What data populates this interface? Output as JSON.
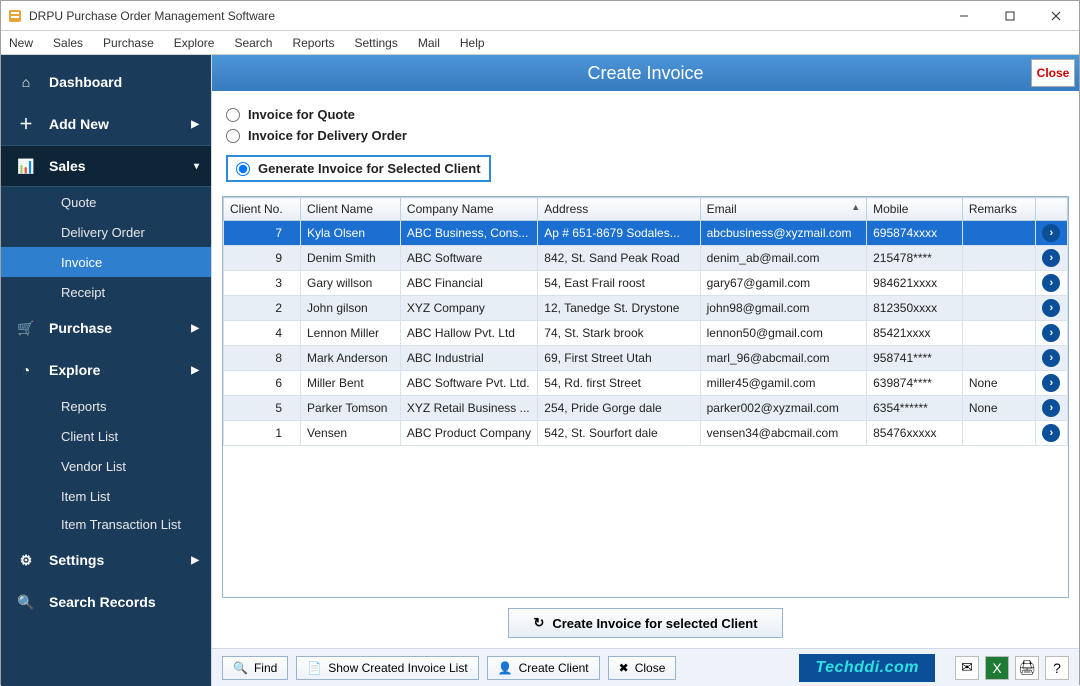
{
  "window": {
    "title": "DRPU Purchase Order Management Software"
  },
  "menubar": [
    "New",
    "Sales",
    "Purchase",
    "Explore",
    "Search",
    "Reports",
    "Settings",
    "Mail",
    "Help"
  ],
  "sidebar": {
    "dashboard": "Dashboard",
    "add_new": "Add New",
    "sales": {
      "label": "Sales",
      "items": [
        "Quote",
        "Delivery Order",
        "Invoice",
        "Receipt"
      ]
    },
    "purchase": "Purchase",
    "explore": {
      "label": "Explore",
      "items": [
        "Reports",
        "Client List",
        "Vendor List",
        "Item List",
        "Item Transaction List"
      ]
    },
    "settings": "Settings",
    "search": "Search Records"
  },
  "page": {
    "title": "Create Invoice",
    "close": "Close",
    "radios": {
      "quote": "Invoice for Quote",
      "delivery": "Invoice for Delivery Order",
      "client": "Generate Invoice for Selected Client"
    },
    "create_btn": "Create Invoice for selected Client"
  },
  "table": {
    "headers": [
      "Client No.",
      "Client Name",
      "Company Name",
      "Address",
      "Email",
      "Mobile",
      "Remarks",
      ""
    ],
    "rows": [
      {
        "no": "7",
        "name": "Kyla Olsen",
        "company": "ABC Business, Cons...",
        "address": "Ap # 651-8679 Sodales...",
        "email": "abcbusiness@xyzmail.com",
        "mobile": "695874xxxx",
        "remarks": "",
        "sel": true
      },
      {
        "no": "9",
        "name": "Denim Smith",
        "company": "ABC Software",
        "address": "842, St. Sand Peak Road",
        "email": "denim_ab@mail.com",
        "mobile": "215478****",
        "remarks": ""
      },
      {
        "no": "3",
        "name": "Gary willson",
        "company": "ABC Financial",
        "address": "54, East Frail roost",
        "email": "gary67@gamil.com",
        "mobile": "984621xxxx",
        "remarks": ""
      },
      {
        "no": "2",
        "name": "John gilson",
        "company": "XYZ Company",
        "address": "12, Tanedge St. Drystone",
        "email": "john98@gmail.com",
        "mobile": "812350xxxx",
        "remarks": ""
      },
      {
        "no": "4",
        "name": "Lennon Miller",
        "company": "ABC Hallow Pvt. Ltd",
        "address": "74, St. Stark brook",
        "email": "lennon50@gmail.com",
        "mobile": "85421xxxx",
        "remarks": ""
      },
      {
        "no": "8",
        "name": "Mark Anderson",
        "company": "ABC Industrial",
        "address": "69, First Street Utah",
        "email": "marl_96@abcmail.com",
        "mobile": "958741****",
        "remarks": ""
      },
      {
        "no": "6",
        "name": "Miller Bent",
        "company": "ABC Software Pvt. Ltd.",
        "address": "54, Rd. first Street",
        "email": "miller45@gamil.com",
        "mobile": "639874****",
        "remarks": "None"
      },
      {
        "no": "5",
        "name": "Parker Tomson",
        "company": "XYZ Retail Business ...",
        "address": "254, Pride Gorge dale",
        "email": "parker002@xyzmail.com",
        "mobile": "6354******",
        "remarks": "None"
      },
      {
        "no": "1",
        "name": "Vensen",
        "company": "ABC Product Company",
        "address": "542, St. Sourfort dale",
        "email": "vensen34@abcmail.com",
        "mobile": "85476xxxxx",
        "remarks": ""
      }
    ]
  },
  "toolbar": {
    "find": "Find",
    "show_list": "Show Created Invoice List",
    "create_client": "Create Client",
    "close": "Close",
    "brand": "Techddi.com"
  }
}
